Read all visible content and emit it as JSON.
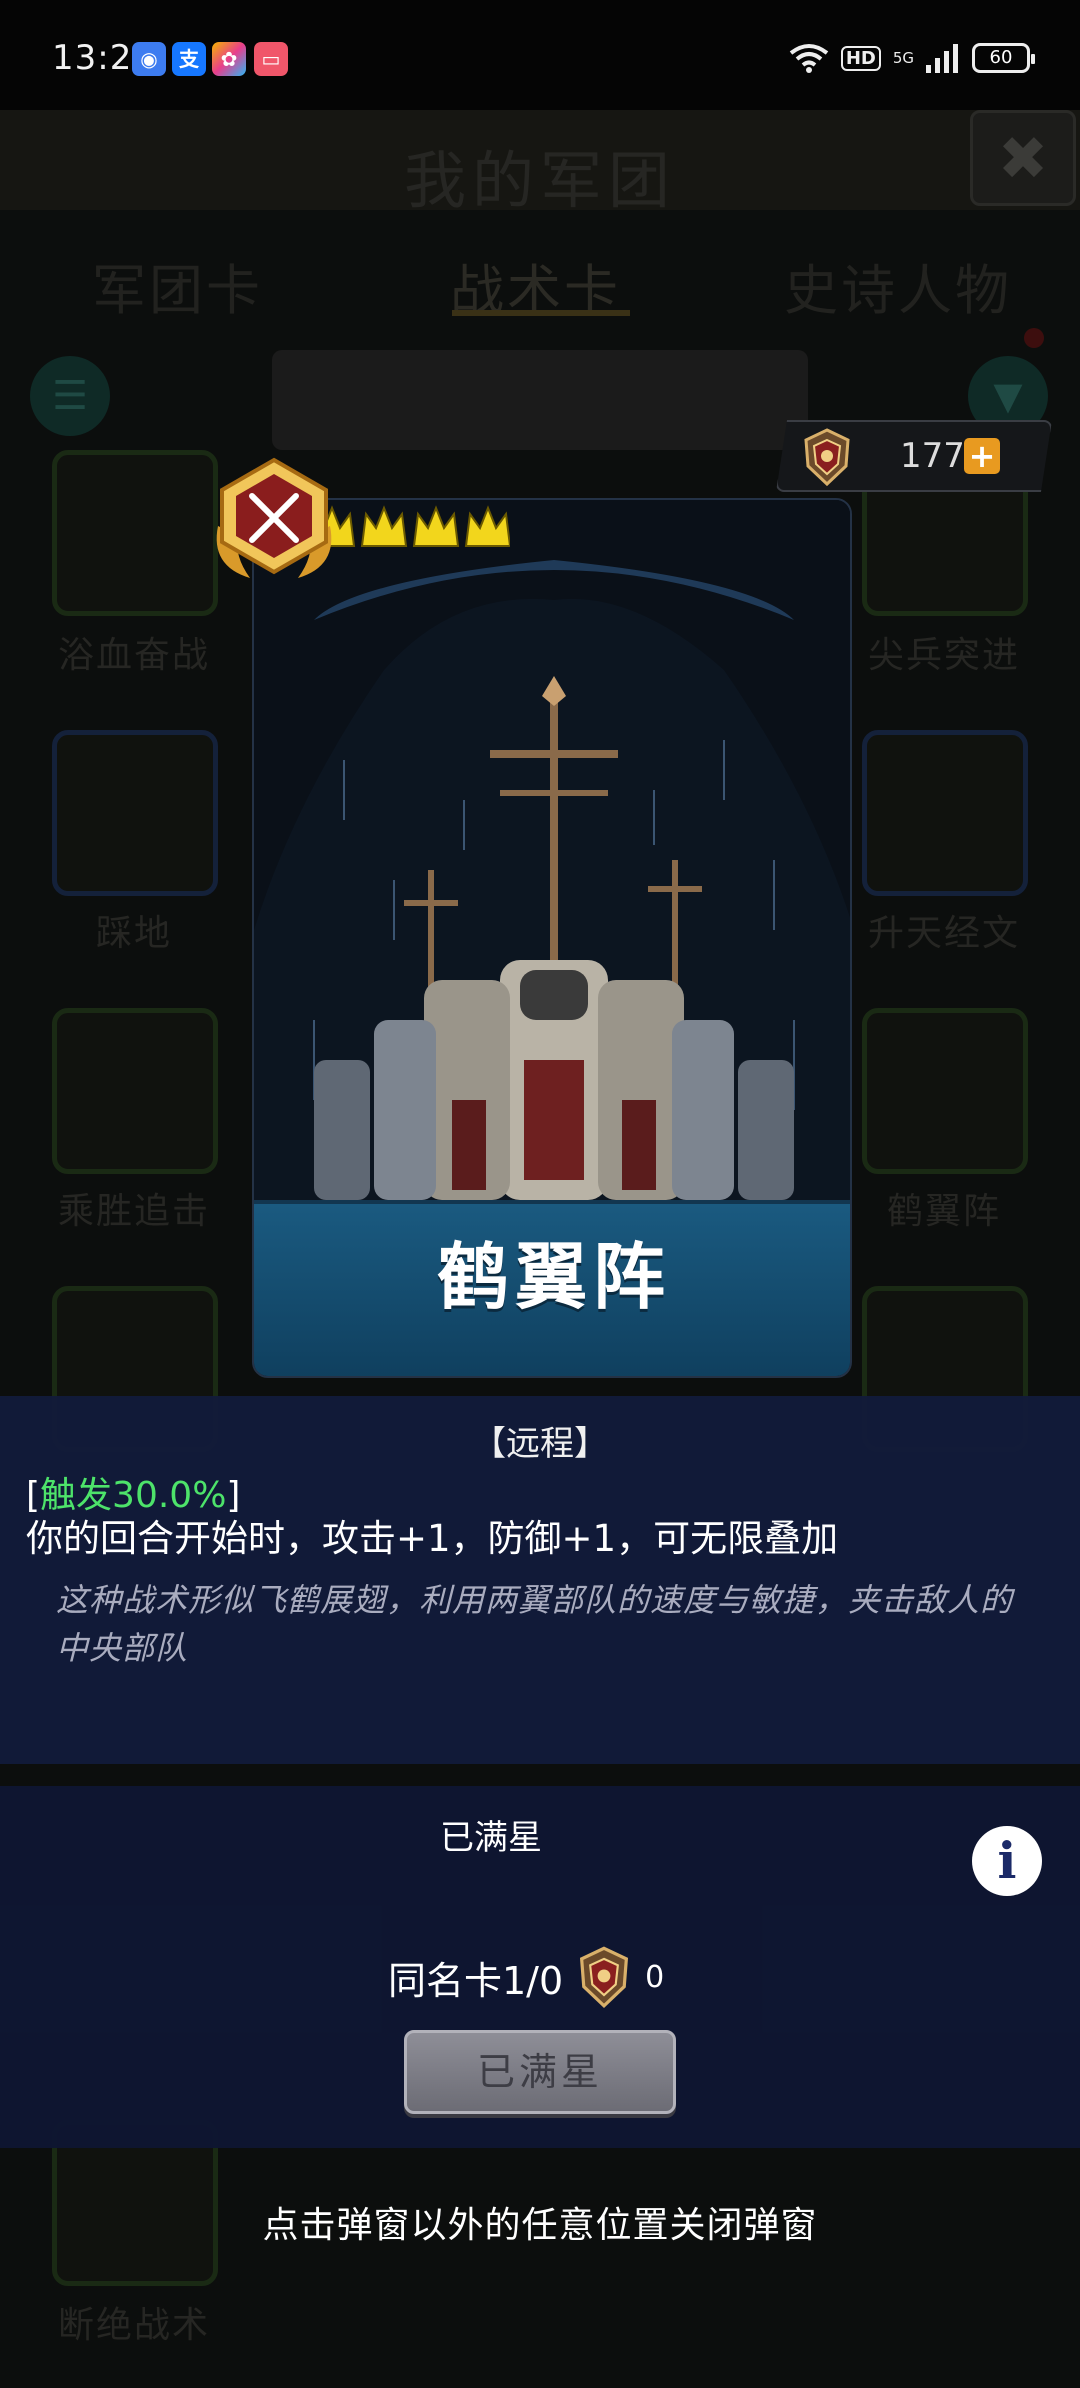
{
  "status_bar": {
    "time": "13:26",
    "hd": "HD",
    "network": "5G",
    "battery": "60"
  },
  "background": {
    "title": "我的军团",
    "close_glyph": "✖",
    "tabs": [
      "军团卡",
      "战术卡",
      "史诗人物"
    ],
    "cards": [
      {
        "label": "浴血奋战"
      },
      {
        "label": "尖兵突进"
      },
      {
        "label": "踩地"
      },
      {
        "label": "升天经文"
      },
      {
        "label": "乘胜追击"
      },
      {
        "label": "鹤翼阵"
      },
      {
        "label": "断绝战术"
      }
    ]
  },
  "currency": {
    "value": "177",
    "plus": "+",
    "icon": "legion-emblem-icon",
    "accent": "#e89a20"
  },
  "card": {
    "name": "鹤翼阵",
    "stars": 5,
    "badge_icon": "crossed-swords-badge-icon"
  },
  "description": {
    "type": "【远程】",
    "trigger_prefix": "[",
    "trigger_label": "触发30.0%",
    "trigger_suffix": "]",
    "effect": "你的回合开始时，攻击+1，防御+1，可无限叠加",
    "flavor": "这种战术形似飞鹤展翅，利用两翼部队的速度与敏捷，夹击敌人的中央部队",
    "trigger_color": "#4de36a"
  },
  "star_panel": {
    "status": "已满星",
    "duplicate_label": "同名卡1/0",
    "duplicate_count": "0",
    "button_label": "已满星",
    "info_glyph": "i"
  },
  "hint": "点击弹窗以外的任意位置关闭弹窗"
}
